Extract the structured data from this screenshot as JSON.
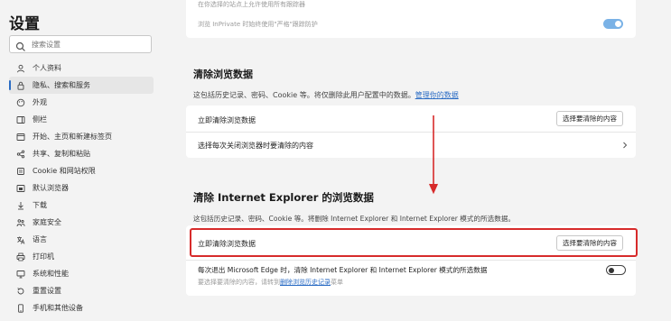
{
  "sidebar": {
    "title": "设置",
    "search_placeholder": "搜索设置",
    "items": [
      {
        "label": "个人资料"
      },
      {
        "label": "隐私、搜索和服务"
      },
      {
        "label": "外观"
      },
      {
        "label": "侧栏"
      },
      {
        "label": "开始、主页和新建标签页"
      },
      {
        "label": "共享、复制和粘贴"
      },
      {
        "label": "Cookie 和网站权限"
      },
      {
        "label": "默认浏览器"
      },
      {
        "label": "下载"
      },
      {
        "label": "家庭安全"
      },
      {
        "label": "语言"
      },
      {
        "label": "打印机"
      },
      {
        "label": "系统和性能"
      },
      {
        "label": "重置设置"
      },
      {
        "label": "手机和其他设备"
      }
    ]
  },
  "top_card": {
    "line1": "在你选择的站点上允许使用所有跟踪器",
    "line2": "浏览 InPrivate 时始终使用\"严格\"跟踪防护",
    "toggle_on": true
  },
  "clear_data": {
    "title": "清除浏览数据",
    "desc": "这包括历史记录、密码、Cookie 等。将仅删除此用户配置中的数据。",
    "desc_link": "管理你的数据",
    "row1_label": "立即清除浏览数据",
    "row1_button": "选择要清除的内容",
    "row2_label": "选择每次关闭浏览器时要清除的内容"
  },
  "clear_ie": {
    "title": "清除 Internet Explorer 的浏览数据",
    "desc": "这包括历史记录、密码、Cookie 等。将删除 Internet Explorer 和 Internet Explorer 模式的所选数据。",
    "row1_label": "立即清除浏览数据",
    "row1_button": "选择要清除的内容",
    "row2_label": "每次退出 Microsoft Edge 时，清除 Internet Explorer 和 Internet Explorer 模式的所选数据",
    "row2_sub": "要选择要清除的内容，请转到",
    "row2_sub_link": "删除浏览历史记录",
    "row2_sub_tail": "菜单",
    "toggle_on": false
  },
  "colors": {
    "accent": "#2b6cc4",
    "highlight": "#d72b2b",
    "toggle_on": "#7ab2e6"
  }
}
